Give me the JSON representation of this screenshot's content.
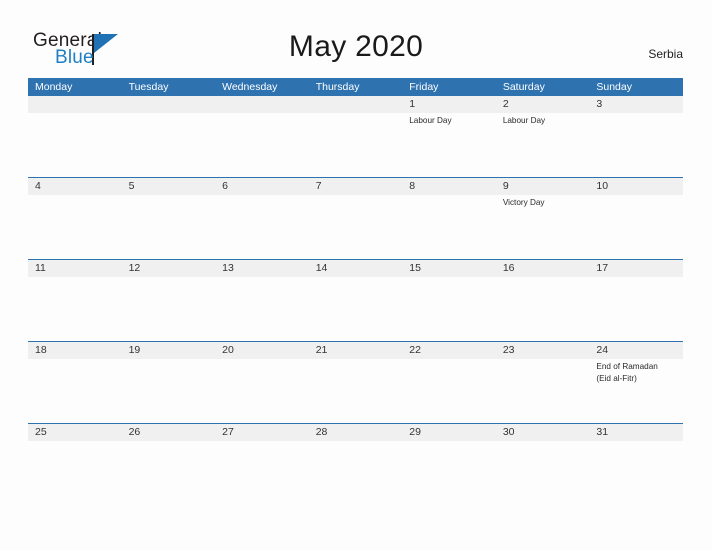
{
  "brand": {
    "name_part1": "General",
    "name_part2": "Blue",
    "triangle_icon": "brand-triangle-icon",
    "accent_color": "#2171b5"
  },
  "header": {
    "title": "May 2020",
    "country": "Serbia"
  },
  "theme": {
    "header_blue": "#2e72b0",
    "daynum_band": "#f0f0f0",
    "page_background": "#fdfdfd",
    "text_dark": "#333333"
  },
  "calendar": {
    "month": "May",
    "year": "2020",
    "weekday_headers": [
      "Monday",
      "Tuesday",
      "Wednesday",
      "Thursday",
      "Friday",
      "Saturday",
      "Sunday"
    ],
    "weeks": [
      [
        {
          "day": "",
          "events": []
        },
        {
          "day": "",
          "events": []
        },
        {
          "day": "",
          "events": []
        },
        {
          "day": "",
          "events": []
        },
        {
          "day": "1",
          "events": [
            "Labour Day"
          ]
        },
        {
          "day": "2",
          "events": [
            "Labour Day"
          ]
        },
        {
          "day": "3",
          "events": []
        }
      ],
      [
        {
          "day": "4",
          "events": []
        },
        {
          "day": "5",
          "events": []
        },
        {
          "day": "6",
          "events": []
        },
        {
          "day": "7",
          "events": []
        },
        {
          "day": "8",
          "events": []
        },
        {
          "day": "9",
          "events": [
            "Victory Day"
          ]
        },
        {
          "day": "10",
          "events": []
        }
      ],
      [
        {
          "day": "11",
          "events": []
        },
        {
          "day": "12",
          "events": []
        },
        {
          "day": "13",
          "events": []
        },
        {
          "day": "14",
          "events": []
        },
        {
          "day": "15",
          "events": []
        },
        {
          "day": "16",
          "events": []
        },
        {
          "day": "17",
          "events": []
        }
      ],
      [
        {
          "day": "18",
          "events": []
        },
        {
          "day": "19",
          "events": []
        },
        {
          "day": "20",
          "events": []
        },
        {
          "day": "21",
          "events": []
        },
        {
          "day": "22",
          "events": []
        },
        {
          "day": "23",
          "events": []
        },
        {
          "day": "24",
          "events": [
            "End of Ramadan",
            "(Eid al-Fitr)"
          ]
        }
      ],
      [
        {
          "day": "25",
          "events": []
        },
        {
          "day": "26",
          "events": []
        },
        {
          "day": "27",
          "events": []
        },
        {
          "day": "28",
          "events": []
        },
        {
          "day": "29",
          "events": []
        },
        {
          "day": "30",
          "events": []
        },
        {
          "day": "31",
          "events": []
        }
      ]
    ]
  }
}
